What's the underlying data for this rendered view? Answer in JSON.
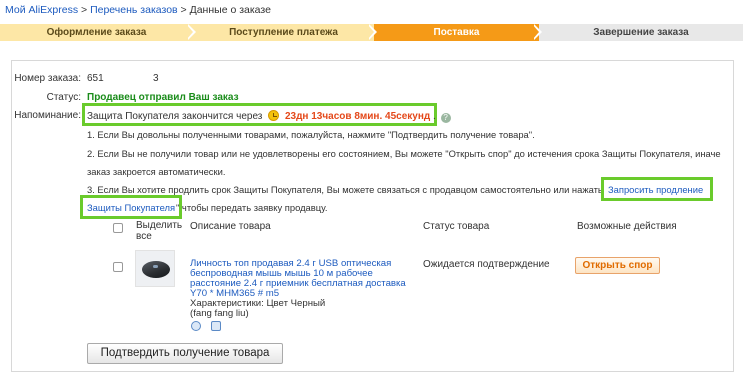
{
  "breadcrumb": {
    "home": "Мой AliExpress",
    "sep": ">",
    "orders": "Перечень заказов",
    "current": "Данные о заказе"
  },
  "steps": [
    {
      "label": "Оформление заказа",
      "state": "done"
    },
    {
      "label": "Поступление платежа",
      "state": "done"
    },
    {
      "label": "Поставка",
      "state": "active"
    },
    {
      "label": "Завершение заказа",
      "state": "pending"
    }
  ],
  "order": {
    "number_label": "Номер заказа:",
    "number_value": "651",
    "number_suffix": "3",
    "status_label": "Статус:",
    "status_value": "Продавец отправил Ваш заказ",
    "reminder_label": "Напоминание:",
    "reminder_text": "Защита Покупателя закончится через",
    "timer": "23дн 13часов 8мин. 45секунд",
    "timer_after": ".",
    "help_icon": "question-icon"
  },
  "notes": {
    "n1": "1. Если Вы довольны полученными товарами, пожалуйста, нажмите \"Подтвердить получение товара\".",
    "n2a": "2. Если Вы не получили товар или не удовлетворены его состоянием, Вы можете \"Открыть спор\" до истечения срока Защиты Покупателя, иначе",
    "n2b": "заказ закроется автоматически.",
    "n3a": "3. Если Вы хотите продлить срок Защиты Покупателя, Вы можете связаться с продавцом самостоятельно или нажать",
    "extend_link_1": "Запросить продление",
    "extend_link_2": "Защиты Покупателя",
    "n3b": "\" чтобы передать заявку продавцу."
  },
  "table": {
    "col_select": "Выделить все",
    "col_select_1": "Выделить",
    "col_select_2": "все",
    "col_desc": "Описание товара",
    "col_status": "Статус товара",
    "col_actions": "Возможные действия"
  },
  "item": {
    "title_lines": [
      "Личность топ продавая 2.4 г USB оптическая",
      "беспроводная мышь мышь 10 м рабочее",
      "расстояние 2.4 г приемник бесплатная доставка",
      "Y70 * MHM365 # m5"
    ],
    "attr_1": "Характеристики: Цвет Черный",
    "attr_2": "(fang fang liu)",
    "status": "Ожидается подтверждение",
    "dispute_button": "Открыть спор"
  },
  "confirm_button": "Подтвердить получение товара",
  "colors": {
    "link": "#1d5bbf",
    "active_step": "#f59a17",
    "done_step": "#fde7a6",
    "status_green": "#1a8c1a",
    "timer_red": "#e4481a",
    "highlight_green": "#6acb2c"
  }
}
